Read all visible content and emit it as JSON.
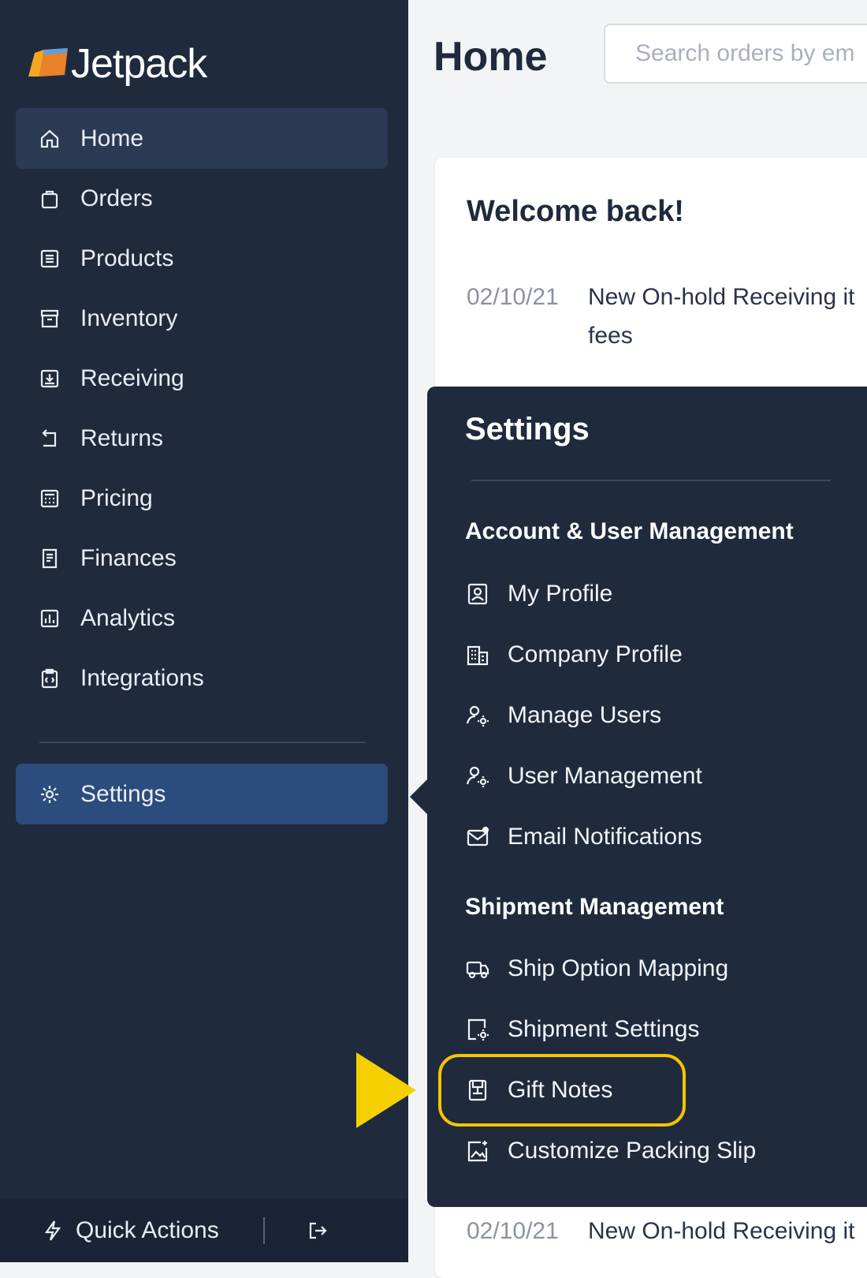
{
  "colors": {
    "sidebar_bg": "#1f2a3d",
    "active_home_bg": "#2c3a54",
    "active_settings_bg": "#2b4c7c",
    "highlight": "#f5c400"
  },
  "brand": {
    "name": "Jetpack",
    "logo_icon": "jetpack-logo-icon"
  },
  "sidebar": {
    "items": [
      {
        "label": "Home",
        "icon": "home-icon"
      },
      {
        "label": "Orders",
        "icon": "shopping-bag-icon"
      },
      {
        "label": "Products",
        "icon": "list-icon"
      },
      {
        "label": "Inventory",
        "icon": "archive-icon"
      },
      {
        "label": "Receiving",
        "icon": "download-box-icon"
      },
      {
        "label": "Returns",
        "icon": "return-icon"
      },
      {
        "label": "Pricing",
        "icon": "calculator-icon"
      },
      {
        "label": "Finances",
        "icon": "receipt-icon"
      },
      {
        "label": "Analytics",
        "icon": "chart-icon"
      },
      {
        "label": "Integrations",
        "icon": "code-clipboard-icon"
      },
      {
        "label": "Settings",
        "icon": "gear-icon"
      }
    ],
    "footer": {
      "quick_actions": "Quick Actions",
      "quick_icon": "lightning-icon",
      "logout_icon": "logout-icon"
    }
  },
  "header": {
    "title": "Home",
    "search_placeholder": "Search orders by em"
  },
  "main": {
    "welcome": "Welcome back!",
    "news": [
      {
        "date": "02/10/21",
        "text_line1": "New On-hold Receiving it",
        "text_line2": "fees"
      },
      {
        "date": "02/10/21",
        "text_line1": "New On-hold Receiving it"
      }
    ]
  },
  "settings_menu": {
    "title": "Settings",
    "sections": [
      {
        "heading": "Account & User Management",
        "items": [
          {
            "label": "My Profile",
            "icon": "profile-icon"
          },
          {
            "label": "Company Profile",
            "icon": "building-icon"
          },
          {
            "label": "Manage Users",
            "icon": "user-gear-icon"
          },
          {
            "label": "User Management",
            "icon": "user-gear-icon"
          },
          {
            "label": "Email Notifications",
            "icon": "mail-icon"
          }
        ]
      },
      {
        "heading": "Shipment Management",
        "items": [
          {
            "label": "Ship Option Mapping",
            "icon": "truck-icon"
          },
          {
            "label": "Shipment Settings",
            "icon": "shipment-settings-icon"
          },
          {
            "label": "Gift Notes",
            "icon": "gift-note-icon"
          },
          {
            "label": "Customize Packing Slip",
            "icon": "image-doc-icon"
          }
        ]
      }
    ]
  }
}
